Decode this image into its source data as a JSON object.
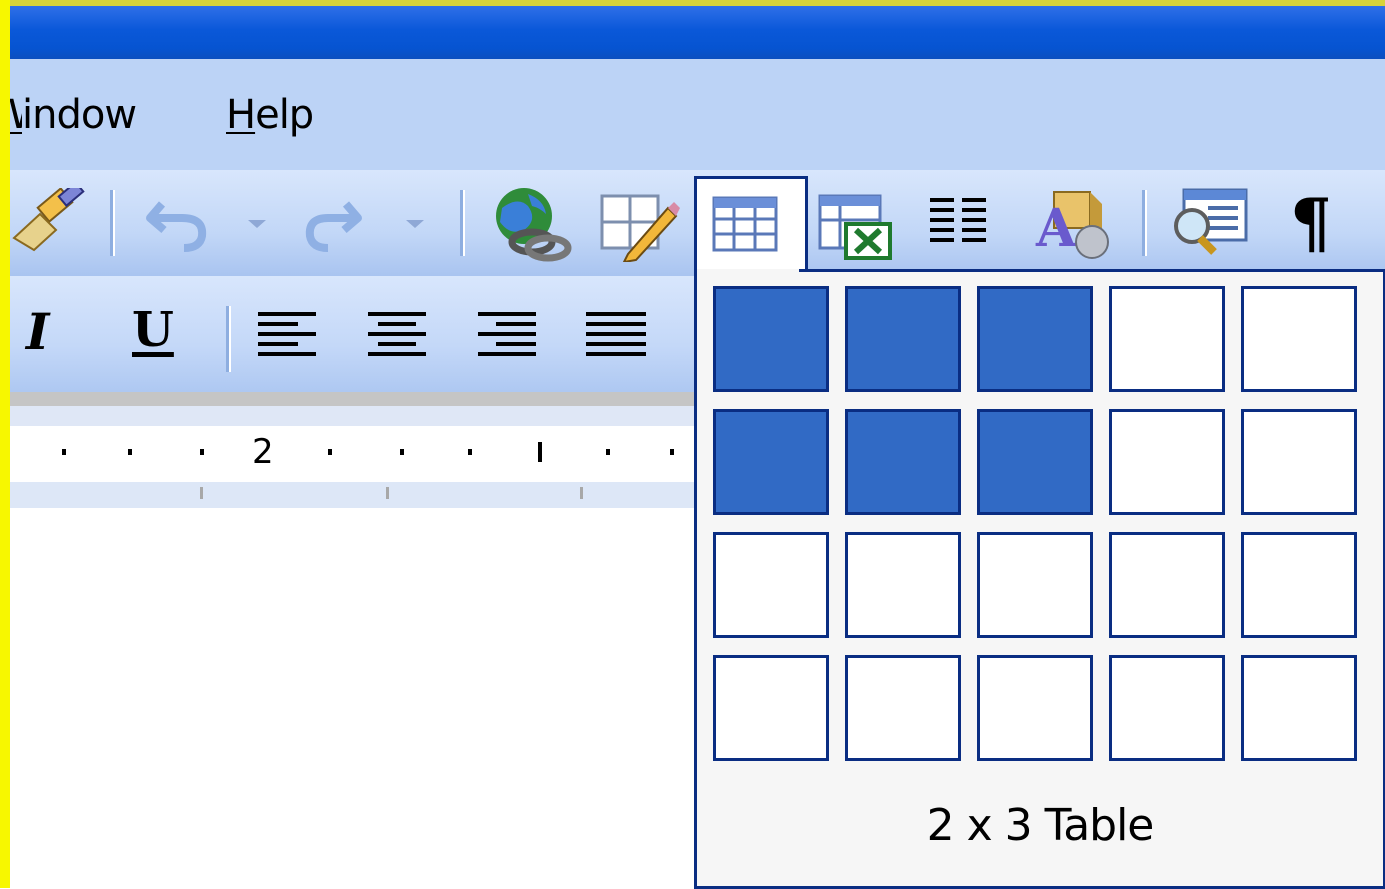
{
  "menubar": {
    "items": [
      {
        "label_visible": "indow",
        "label_partial_prefix": "W",
        "underline": "W"
      },
      {
        "label_pre": "",
        "label_underlined": "H",
        "label_post": "elp"
      }
    ]
  },
  "toolbar_standard": {
    "buttons": [
      {
        "name": "format-painter",
        "icon": "brush-icon"
      },
      {
        "name": "undo",
        "icon": "undo-icon",
        "enabled": false
      },
      {
        "name": "redo",
        "icon": "redo-icon",
        "enabled": false
      },
      {
        "name": "insert-hyperlink",
        "icon": "globe-link-icon"
      },
      {
        "name": "tables-and-borders",
        "icon": "table-pencil-icon"
      },
      {
        "name": "insert-table",
        "icon": "table-icon",
        "pressed": true
      },
      {
        "name": "insert-excel-worksheet",
        "icon": "excel-icon"
      },
      {
        "name": "columns",
        "icon": "columns-icon"
      },
      {
        "name": "drawing",
        "icon": "drawing-icon"
      },
      {
        "name": "document-map",
        "icon": "document-map-icon"
      },
      {
        "name": "show-hide-formatting",
        "icon": "pilcrow-icon",
        "glyph": "¶"
      }
    ]
  },
  "toolbar_formatting": {
    "italic_glyph": "I",
    "underline_glyph": "U",
    "alignments": [
      "align-left",
      "align-center",
      "align-right",
      "justify"
    ]
  },
  "ruler": {
    "label": "2"
  },
  "table_picker": {
    "rows": 4,
    "cols": 5,
    "selected_rows": 2,
    "selected_cols": 3,
    "label": "2 x 3 Table"
  },
  "colors": {
    "selection": "#316ac5",
    "border": "#0a2d82",
    "title_bar": "#0654d1",
    "menu_bg": "#bcd3f6",
    "outline": "#f7f700"
  }
}
